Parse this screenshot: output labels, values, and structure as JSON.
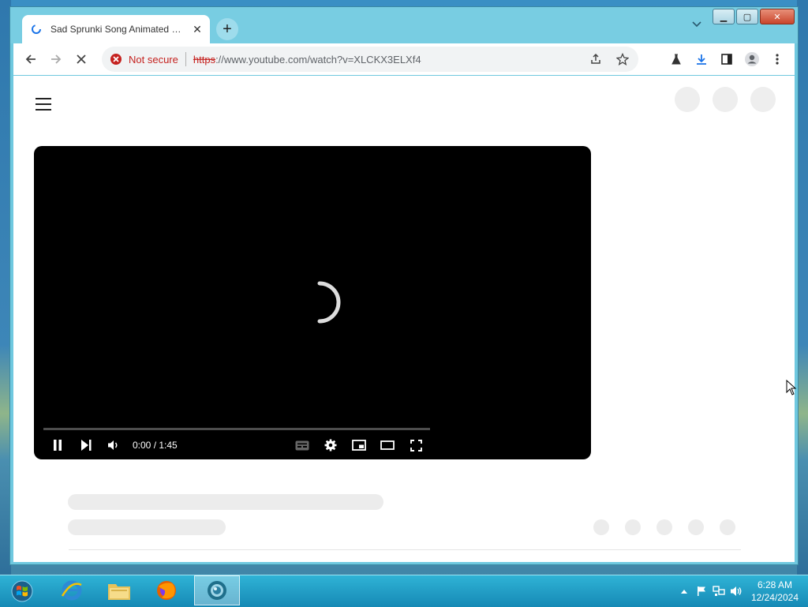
{
  "browser": {
    "tab": {
      "title": "Sad Sprunki Song Animated Music Video",
      "close": "✕"
    },
    "new_tab": "+",
    "window_controls": {
      "minimize": "▁",
      "maximize": "▢",
      "close": "✕"
    },
    "omnibox": {
      "security_label": "Not secure",
      "scheme": "https",
      "rest": "://www.youtube.com/watch?v=XLCKX3ELXf4"
    }
  },
  "player": {
    "time": "0:00 / 1:45",
    "progress": 0
  },
  "taskbar": {
    "clock_time": "6:28 AM",
    "clock_date": "12/24/2024"
  },
  "colors": {
    "accent": "#1a73e8",
    "insecure": "#c5221f",
    "window_frame": "#78cde2"
  }
}
